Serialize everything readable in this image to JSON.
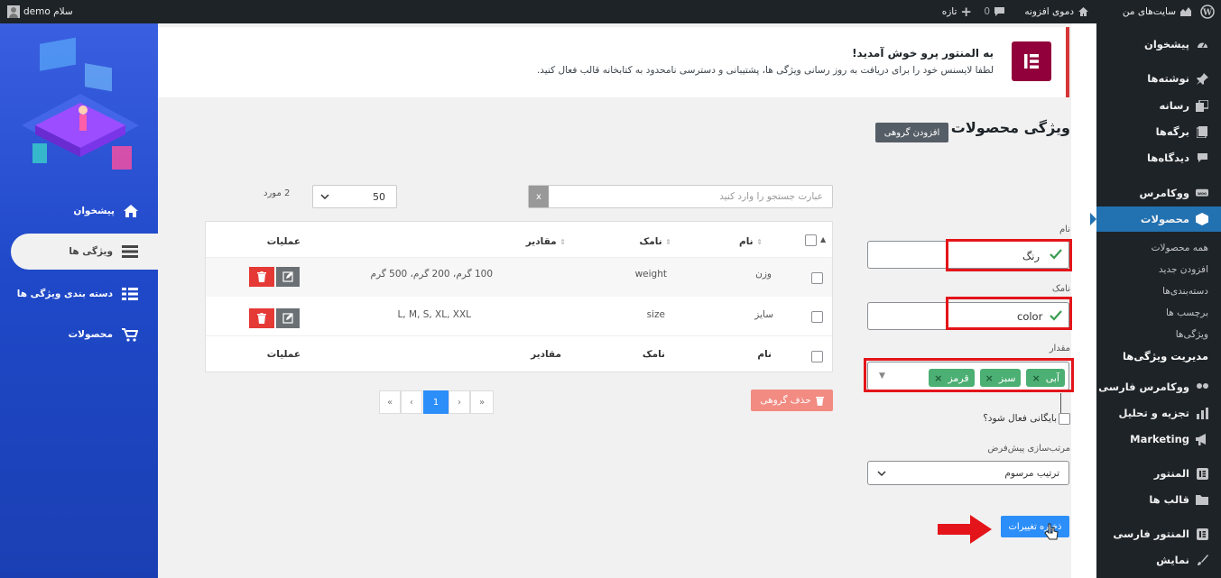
{
  "adminbar": {
    "my_sites": "سایت‌های من",
    "site_name": "دموی افزونه",
    "comments_count": "0",
    "new_label": "تازه",
    "greeting": "سلام demo"
  },
  "wp_menu": {
    "dashboard": "پیشخوان",
    "posts": "نوشته‌ها",
    "media": "رسانه",
    "pages": "برگه‌ها",
    "comments": "دیدگاه‌ها",
    "woocommerce": "ووکامرس",
    "products": "محصولات",
    "sub_all": "همه محصولات",
    "sub_new": "افزودن جدید",
    "sub_cats": "دسته‌بندی‌ها",
    "sub_tags": "برچسب ها",
    "sub_attrs": "ویژگی‌ها",
    "sub_manage": "مدیریت ویژگی‌ها",
    "woo_fa": "ووکامرس فارسی",
    "analytics": "تجزیه و تحلیل",
    "marketing": "Marketing",
    "elementor": "المنتور",
    "templates": "قالب ها",
    "elementor_fa": "المنتور فارسی",
    "appearance": "نمایش"
  },
  "plugin_panel": {
    "dashboard": "پیشخوان",
    "attributes": "ویژگی ها",
    "attr_groups": "دسته بندی ویژگی ها",
    "products": "محصولات"
  },
  "notice": {
    "title": "به المنتور پرو خوش آمدید!",
    "body": "لطفا لایسنس خود را برای دریافت به روز رسانی ویژگی ها، پشتیبانی و دسترسی نامحدود به کتابخانه قالب فعال کنید."
  },
  "page": {
    "title": "ویژگی محصولات",
    "add_group": "افزودن گروهی"
  },
  "form": {
    "name_label": "نام",
    "name_value": "رنگ",
    "slug_label": "نامک",
    "slug_value": "color",
    "value_label": "مقدار",
    "tags": [
      "آبی",
      "سبز",
      "قرمز"
    ],
    "archive_label": "بایگانی فعال شود؟",
    "sort_label": "مرتب‌سازی پیش‌فرض",
    "sort_value": "ترتیب مرسوم",
    "save": "ذخیره تغییرات"
  },
  "list": {
    "search_placeholder": "عبارت جستجو را وارد کنید",
    "search_clear": "x",
    "per_page": "50",
    "count": "2 مورد",
    "headers": {
      "name": "نام",
      "slug": "نامک",
      "values": "مقادیر",
      "ops": "عملیات"
    },
    "rows": [
      {
        "name": "وزن",
        "slug": "weight",
        "values": "100 گرم، 200 گرم، 500 گرم"
      },
      {
        "name": "سایز",
        "slug": "size",
        "values": "L, M, S, XL, XXL"
      }
    ],
    "bulk_delete": "حذف گروهی",
    "pagination": {
      "first": "«",
      "prev": "‹",
      "current": "1",
      "next": "›",
      "last": "»"
    }
  },
  "colors": {
    "accent": "#2271b1",
    "danger": "#e53935",
    "tag": "#4caf73",
    "highlight": "#e3151a",
    "elementor": "#92003b"
  }
}
